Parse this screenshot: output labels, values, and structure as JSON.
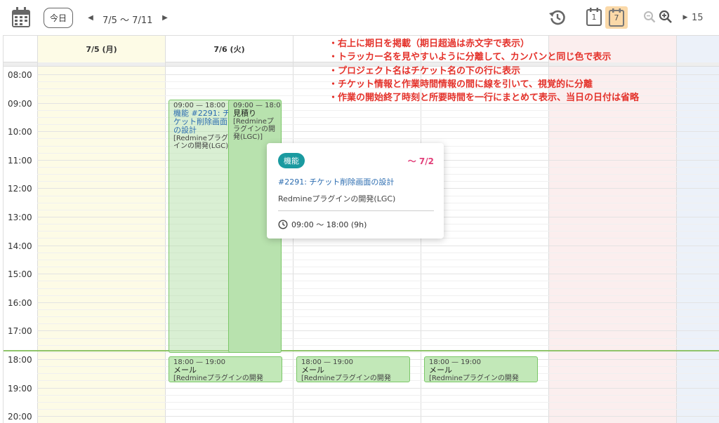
{
  "toolbar": {
    "today_label": "今日",
    "range_label": "7/5 〜 7/11",
    "zoom_value": "15",
    "day_view_icon_text": "1",
    "week_view_icon_text": "7"
  },
  "calendar": {
    "days": [
      {
        "label": "7/5 (月)"
      },
      {
        "label": "7/6 (火)"
      },
      {
        "label": ""
      },
      {
        "label": ""
      },
      {
        "label": ""
      },
      {
        "label": ""
      },
      {
        "label": ""
      }
    ],
    "times": [
      "08:00",
      "09:00",
      "10:00",
      "11:00",
      "12:00",
      "13:00",
      "14:00",
      "15:00",
      "16:00",
      "17:00",
      "18:00",
      "19:00",
      "20:00"
    ]
  },
  "events": {
    "feature": {
      "time": "09:00 — 18:00",
      "name": "機能 #2291: チケット削除画面の設計",
      "project": "[Redmineプラグインの開発(LGC)]"
    },
    "estimate": {
      "time": "09:00 — 18:00",
      "name": "見積り",
      "project": "[Redmineプラグインの開発(LGC)]"
    },
    "mail_tue": {
      "time": "18:00 — 19:00",
      "name": "メール",
      "project": "[Redmineプラグインの開発"
    },
    "mail_wed": {
      "time": "18:00 — 19:00",
      "name": "メール",
      "project": "[Redmineプラグインの開発"
    },
    "mail_thu": {
      "time": "18:00 — 19:00",
      "name": "メール",
      "project": "[Redmineプラグインの開発"
    }
  },
  "popover": {
    "tracker": "機能",
    "due": "〜 7/2",
    "title": "#2291: チケット削除画面の設計",
    "project": "Redmineプラグインの開発(LGC)",
    "time": "09:00 〜 18:00 (9h)"
  },
  "annotations": [
    "・右上に期日を掲載（期日超過は赤文字で表示）",
    "・トラッカー名を見やすいように分離して、カンバンと同じ色で表示",
    "・プロジェクト名はチケット名の下の行に表示",
    "・チケット情報と作業時間情報の間に線を引いて、視覚的に分離",
    "・作業の開始終了時刻と所要時間を一行にまとめて表示、当日の日付は省略"
  ],
  "colors": {
    "accent_tag": "#1a9aa0",
    "due_overdue": "#e2407a",
    "note_red": "#e4322b",
    "event_green": "#b8e2ae",
    "today_col": "#fdfbe6",
    "sat_col": "#fbeeee",
    "sun_col": "#ecf1f9"
  }
}
